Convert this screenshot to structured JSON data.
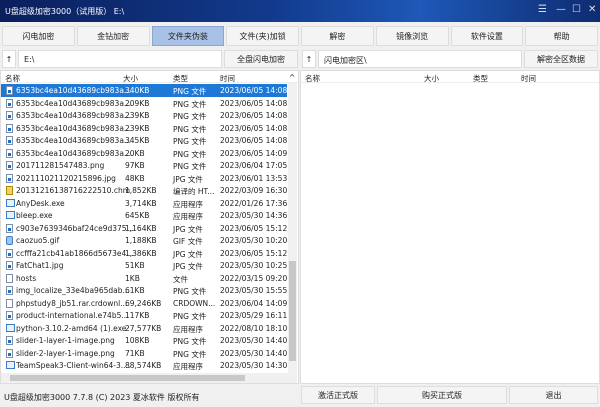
{
  "window": {
    "title": "U盘超级加密3000（试用版） E:\\",
    "menu_icon": "hamburger-icon",
    "minimize_icon": "minimize-icon",
    "maximize_icon": "maximize-icon",
    "close_icon": "close-icon"
  },
  "toolbar": [
    "闪电加密",
    "金钻加密",
    "文件夹伪装",
    "文件(夹)加锁",
    "解密",
    "镜像浏览",
    "软件设置",
    "帮助"
  ],
  "left": {
    "path": "E:\\",
    "action": "全盘闪电加密",
    "columns": [
      "名称",
      "大小",
      "类型",
      "时间"
    ],
    "files": [
      {
        "name": "6353bc4ea10d43689cb983a...",
        "size": "340KB",
        "type": "PNG 文件",
        "time": "2023/06/05 14:08",
        "icon": "png",
        "selected": true
      },
      {
        "name": "6353bc4ea10d43689cb983a...",
        "size": "209KB",
        "type": "PNG 文件",
        "time": "2023/06/05 14:08",
        "icon": "png"
      },
      {
        "name": "6353bc4ea10d43689cb983a...",
        "size": "239KB",
        "type": "PNG 文件",
        "time": "2023/06/05 14:08",
        "icon": "png"
      },
      {
        "name": "6353bc4ea10d43689cb983a...",
        "size": "239KB",
        "type": "PNG 文件",
        "time": "2023/06/05 14:08",
        "icon": "png"
      },
      {
        "name": "6353bc4ea10d43689cb983a...",
        "size": "345KB",
        "type": "PNG 文件",
        "time": "2023/06/05 14:08",
        "icon": "png"
      },
      {
        "name": "6353bc4ea10d43689cb983a...",
        "size": "20KB",
        "type": "PNG 文件",
        "time": "2023/06/05 14:09",
        "icon": "png"
      },
      {
        "name": "201711281547483.png",
        "size": "97KB",
        "type": "PNG 文件",
        "time": "2023/06/04 17:05",
        "icon": "png"
      },
      {
        "name": "202111021120215896.jpg",
        "size": "48KB",
        "type": "JPG 文件",
        "time": "2023/06/01 13:53",
        "icon": "jpg"
      },
      {
        "name": "20131216138716222510.chm",
        "size": "1,852KB",
        "type": "编译的 HT...",
        "time": "2022/03/09 16:30",
        "icon": "chm"
      },
      {
        "name": "AnyDesk.exe",
        "size": "3,714KB",
        "type": "应用程序",
        "time": "2022/01/26 17:36",
        "icon": "exe"
      },
      {
        "name": "bleep.exe",
        "size": "645KB",
        "type": "应用程序",
        "time": "2023/05/30 14:36",
        "icon": "exe"
      },
      {
        "name": "c903e7639346baf24ce9d375...",
        "size": "1,164KB",
        "type": "JPG 文件",
        "time": "2023/06/05 15:12",
        "icon": "jpg"
      },
      {
        "name": "caozuo5.gif",
        "size": "1,188KB",
        "type": "GIF 文件",
        "time": "2023/05/30 10:20",
        "icon": "gif"
      },
      {
        "name": "ccfffa21cb41ab1866d5673e4...",
        "size": "1,386KB",
        "type": "JPG 文件",
        "time": "2023/06/05 15:12",
        "icon": "jpg"
      },
      {
        "name": "FatChat1.jpg",
        "size": "51KB",
        "type": "JPG 文件",
        "time": "2023/05/30 10:25",
        "icon": "jpg"
      },
      {
        "name": "hosts",
        "size": "1KB",
        "type": "文件",
        "time": "2022/03/15 09:20",
        "icon": "file"
      },
      {
        "name": "img_localize_33e4ba965dab...",
        "size": "61KB",
        "type": "PNG 文件",
        "time": "2023/05/30 15:55",
        "icon": "png"
      },
      {
        "name": "phpstudy8_jb51.rar.crdownl...",
        "size": "69,246KB",
        "type": "CRDOWN...",
        "time": "2023/06/04 14:09",
        "icon": "file"
      },
      {
        "name": "product-international.e74b5...",
        "size": "117KB",
        "type": "PNG 文件",
        "time": "2023/05/29 16:11",
        "icon": "png"
      },
      {
        "name": "python-3.10.2-amd64 (1).exe",
        "size": "27,577KB",
        "type": "应用程序",
        "time": "2022/08/10 18:10",
        "icon": "exe"
      },
      {
        "name": "slider-1-layer-1-image.png",
        "size": "108KB",
        "type": "PNG 文件",
        "time": "2023/05/30 14:40",
        "icon": "png"
      },
      {
        "name": "slider-2-layer-1-image.png",
        "size": "71KB",
        "type": "PNG 文件",
        "time": "2023/05/30 14:40",
        "icon": "png"
      },
      {
        "name": "TeamSpeak3-Client-win64-3....",
        "size": "88,574KB",
        "type": "应用程序",
        "time": "2023/05/30 14:30",
        "icon": "exe"
      }
    ]
  },
  "right": {
    "path": "闪电加密区\\",
    "action": "解密全区数据",
    "columns": [
      "名称",
      "大小",
      "类型",
      "时间"
    ]
  },
  "status": "U盘超级加密3000  7.7.8  (C)  2023  夏冰软件 版权所有",
  "bottom": {
    "activate": "激活正式版",
    "buy": "购买正式版",
    "exit": "退出"
  },
  "colors": {
    "title_bar": "#123a8c",
    "selected_row": "#1e78d6",
    "active_tab": "#a9c1e6"
  }
}
